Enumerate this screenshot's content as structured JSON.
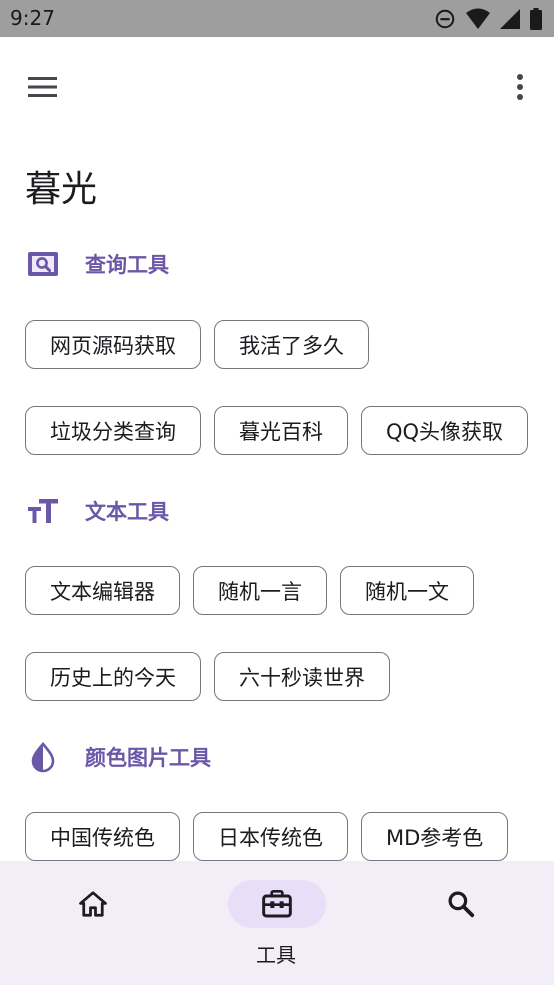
{
  "status_bar": {
    "time": "9:27",
    "icons": [
      "do-not-disturb-icon",
      "wifi-icon",
      "signal-icon",
      "battery-icon"
    ]
  },
  "app_bar": {
    "menu_icon": "hamburger-menu-icon",
    "more_icon": "more-vert-icon"
  },
  "page": {
    "title": "暮光"
  },
  "sections": [
    {
      "label": "查询工具",
      "icon": "image-search-icon",
      "rows": [
        [
          "网页源码获取",
          "我活了多久"
        ],
        [
          "垃圾分类查询",
          "暮光百科",
          "QQ头像获取"
        ]
      ]
    },
    {
      "label": "文本工具",
      "icon": "text-fields-icon",
      "rows": [
        [
          "文本编辑器",
          "随机一言",
          "随机一文"
        ],
        [
          "历史上的今天",
          "六十秒读世界"
        ]
      ]
    },
    {
      "label": "颜色图片工具",
      "icon": "invert-colors-icon",
      "rows": [
        [
          "中国传统色",
          "日本传统色",
          "MD参考色"
        ]
      ]
    }
  ],
  "bottom_nav": {
    "items": [
      {
        "icon": "home-icon",
        "label": "",
        "active": false
      },
      {
        "icon": "toolbox-icon",
        "label": "工具",
        "active": true
      },
      {
        "icon": "search-icon",
        "label": "",
        "active": false
      }
    ]
  },
  "colors": {
    "accent": "#6b57a8",
    "nav_background": "#f3edf7",
    "nav_indicator": "#e8def8",
    "status_bar": "#9e9e9e"
  }
}
